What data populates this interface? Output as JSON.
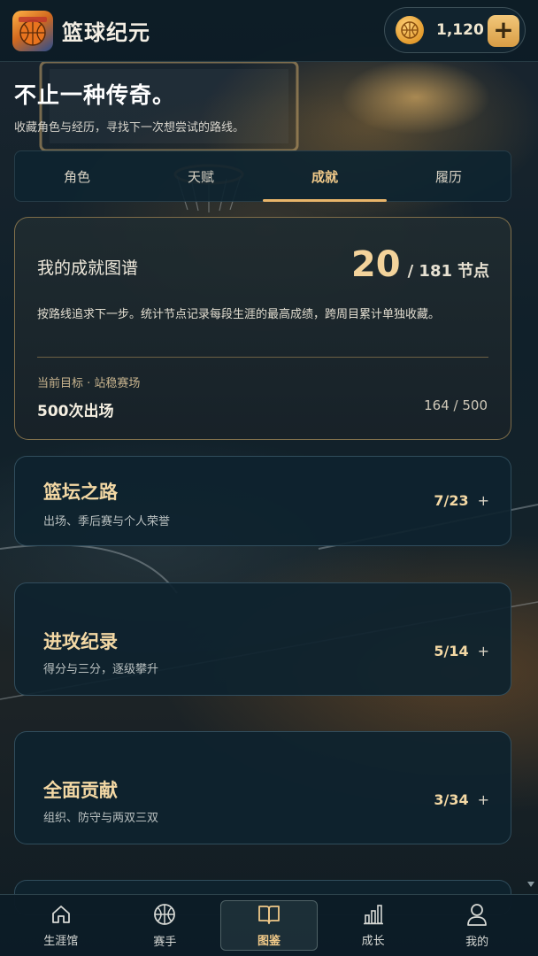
{
  "app": {
    "title": "篮球纪元",
    "coins": "1,120",
    "add_label": "+"
  },
  "hero": {
    "title": "不止一种传奇。",
    "subtitle": "收藏角色与经历，寻找下一次想尝试的路线。"
  },
  "tabs": [
    {
      "label": "角色",
      "active": false
    },
    {
      "label": "天赋",
      "active": false
    },
    {
      "label": "成就",
      "active": true
    },
    {
      "label": "履历",
      "active": false
    }
  ],
  "achievement_map": {
    "title": "我的成就图谱",
    "unlocked": "20",
    "total": "/ 181",
    "unit": "节点",
    "description": "按路线追求下一步。统计节点记录每段生涯的最高成绩，跨周目累计单独收藏。",
    "goal_label": "当前目标 · 站稳赛场",
    "goal_name": "500次出场",
    "goal_progress": "164 / 500"
  },
  "categories": [
    {
      "title": "篮坛之路",
      "subtitle": "出场、季后赛与个人荣誉",
      "count": "7/23",
      "expand": "+"
    },
    {
      "title": "进攻纪录",
      "subtitle": "得分与三分，逐级攀升",
      "count": "5/14",
      "expand": "+"
    },
    {
      "title": "全面贡献",
      "subtitle": "组织、防守与两双三双",
      "count": "3/34",
      "expand": "+"
    }
  ],
  "bottom_nav": [
    {
      "label": "生涯馆",
      "icon": "home-icon",
      "active": false
    },
    {
      "label": "赛手",
      "icon": "basketball-icon",
      "active": false
    },
    {
      "label": "图鉴",
      "icon": "book-icon",
      "active": true
    },
    {
      "label": "成长",
      "icon": "bar-chart-icon",
      "active": false
    },
    {
      "label": "我的",
      "icon": "user-icon",
      "active": false
    }
  ],
  "colors": {
    "accent_gold": "#f0c989",
    "panel_bg": "#0e222e",
    "card_border_gold": "#d4aa64"
  }
}
